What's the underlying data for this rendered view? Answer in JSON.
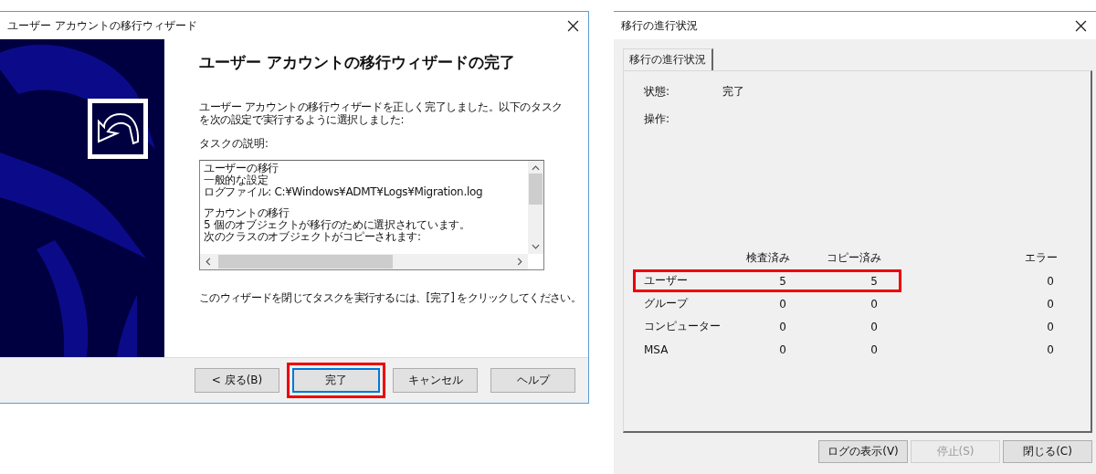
{
  "wizard": {
    "title": "ユーザー アカウントの移行ウィザード",
    "heading": "ユーザー アカウントの移行ウィザードの完了",
    "intro": "ユーザー アカウントの移行ウィザードを正しく完了しました。以下のタスクを次の設定で実行するように選択しました:",
    "task_label": "タスクの説明:",
    "task_sections": [
      {
        "lines": [
          "ユーザーの移行",
          "一般的な設定",
          "ログファイル: C:¥Windows¥ADMT¥Logs¥Migration.log"
        ]
      },
      {
        "lines": [
          "アカウントの移行",
          "5 個のオブジェクトが移行のために選択されています。",
          "次のクラスのオブジェクトがコピーされます:"
        ]
      }
    ],
    "footer": "このウィザードを閉じてタスクを実行するには、[完了] をクリックしてください。",
    "buttons": [
      {
        "label": "< 戻る(B)",
        "focused": false,
        "highlighted": false
      },
      {
        "label": "完了",
        "focused": true,
        "highlighted": true
      },
      {
        "label": "キャンセル",
        "focused": false,
        "highlighted": false
      },
      {
        "label": "ヘルプ",
        "focused": false,
        "highlighted": false
      }
    ]
  },
  "progress": {
    "title": "移行の進行状況",
    "tabs": [
      {
        "label": "移行の進行状況",
        "selected": true
      }
    ],
    "status_label": "状態:",
    "status_value": "完了",
    "operation_label": "操作:",
    "columns": [
      "検査済み",
      "コピー済み",
      "エラー"
    ],
    "rows": [
      {
        "name": "ユーザー",
        "checked": "5",
        "copied": "5",
        "errors": "0",
        "highlighted": true
      },
      {
        "name": "グループ",
        "checked": "0",
        "copied": "0",
        "errors": "0",
        "highlighted": false
      },
      {
        "name": "コンピューター",
        "checked": "0",
        "copied": "0",
        "errors": "0",
        "highlighted": false
      },
      {
        "name": "MSA",
        "checked": "0",
        "copied": "0",
        "errors": "0",
        "highlighted": false
      }
    ],
    "buttons": [
      {
        "label": "ログの表示(V)",
        "disabled": false
      },
      {
        "label": "停止(S)",
        "disabled": true
      },
      {
        "label": "閉じる(C)",
        "disabled": false
      }
    ]
  }
}
